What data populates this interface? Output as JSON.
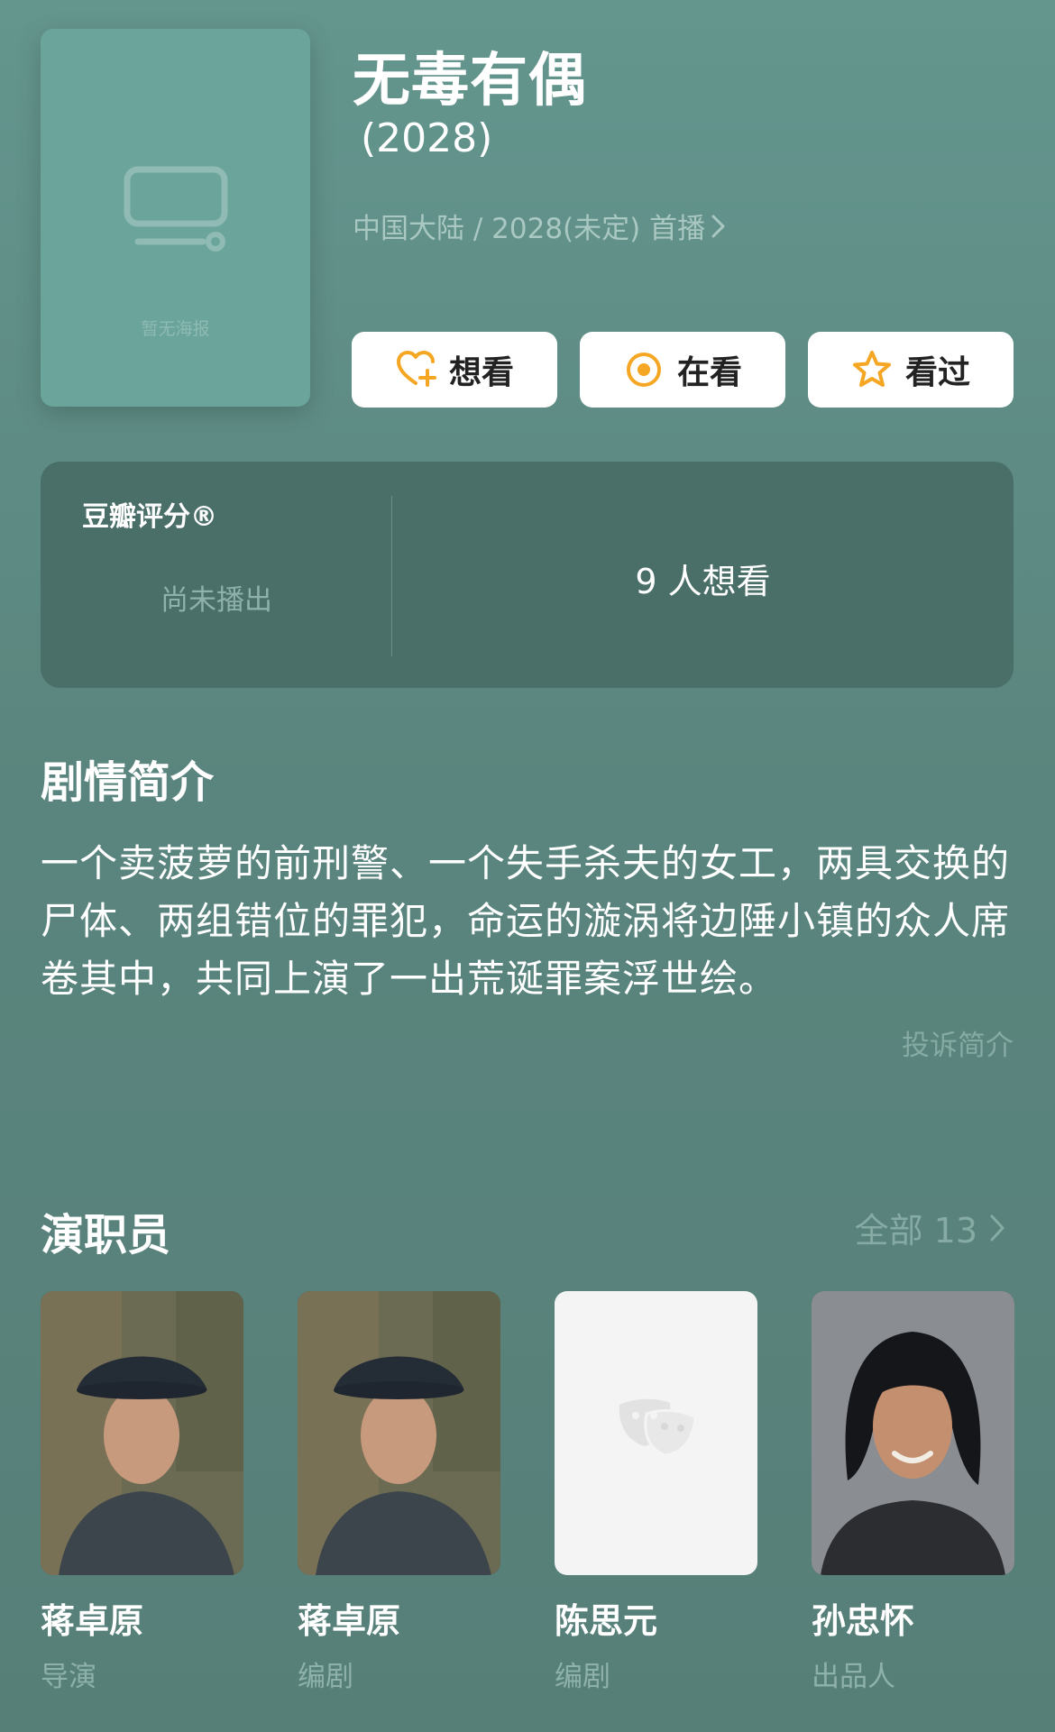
{
  "header": {
    "poster_placeholder": "暂无海报",
    "title": "无毒有偶",
    "year": "(2028)",
    "meta": "中国大陆 / 2028(未定) 首播"
  },
  "actions": {
    "want_label": "想看",
    "watching_label": "在看",
    "watched_label": "看过",
    "accent_color": "#f5a623"
  },
  "rating": {
    "title": "豆瓣评分®",
    "status": "尚未播出",
    "want_count": "9 人想看"
  },
  "synopsis": {
    "title": "剧情简介",
    "text": "一个卖菠萝的前刑警、一个失手杀夫的女工，两具交换的尸体、两组错位的罪犯，命运的漩涡将边陲小镇的众人席卷其中，共同上演了一出荒诞罪案浮世绘。",
    "complaint_link": "投诉简介"
  },
  "cast": {
    "title": "演职员",
    "all_link": "全部 13",
    "members": [
      {
        "name": "蒋卓原",
        "role": "导演"
      },
      {
        "name": "蒋卓原",
        "role": "编剧"
      },
      {
        "name": "陈思元",
        "role": "编剧"
      },
      {
        "name": "孙忠怀",
        "role": "出品人"
      }
    ]
  }
}
